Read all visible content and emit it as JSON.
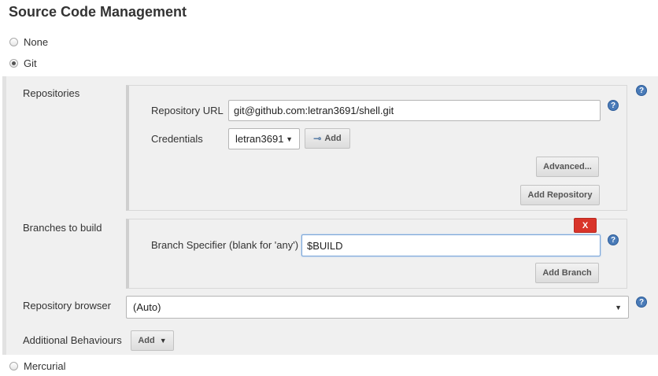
{
  "section": {
    "title": "Source Code Management"
  },
  "scm_options": [
    {
      "label": "None",
      "selected": false
    },
    {
      "label": "Git",
      "selected": true
    },
    {
      "label": "Mercurial",
      "selected": false
    }
  ],
  "repositories": {
    "label": "Repositories",
    "url_label": "Repository URL",
    "url_value": "git@github.com:letran3691/shell.git",
    "credentials_label": "Credentials",
    "credentials_value": "letran3691",
    "add_label": "Add",
    "advanced_label": "Advanced...",
    "add_repository_label": "Add Repository"
  },
  "branches": {
    "label": "Branches to build",
    "delete_label": "X",
    "specifier_label": "Branch Specifier (blank for 'any')",
    "specifier_value": "$BUILD",
    "add_branch_label": "Add Branch"
  },
  "repository_browser": {
    "label": "Repository browser",
    "value": "(Auto)"
  },
  "additional_behaviours": {
    "label": "Additional Behaviours",
    "add_label": "Add"
  },
  "help_icon_text": "?",
  "colors": {
    "help": "#4a7bb8",
    "delete": "#d9342a",
    "band": "#f0f0f0"
  }
}
